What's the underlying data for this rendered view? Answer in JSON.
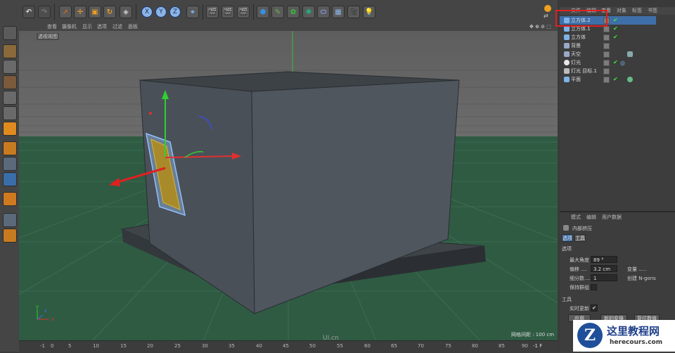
{
  "toolbar": {
    "axes": [
      "X",
      "Y",
      "Z"
    ]
  },
  "viewport": {
    "menu": [
      "查看",
      "摄像机",
      "显示",
      "选项",
      "过滤",
      "面板"
    ],
    "view_label": "透视视图",
    "grid_spacing": "网格间距 : 100 cm",
    "corner_icons": "✥ ⊕ ⊘ ⬚",
    "timeline": {
      "ticks": [
        "-1",
        "0",
        "5",
        "10",
        "15",
        "20",
        "25",
        "30",
        "35",
        "40",
        "45",
        "50",
        "55",
        "60",
        "65",
        "70",
        "75",
        "80",
        "85",
        "90"
      ],
      "frame": "-1 F"
    },
    "watermark": "UI.cn",
    "axis_gizmo": [
      "y",
      "z",
      "x"
    ]
  },
  "object_manager": {
    "menu": [
      "文件",
      "编辑",
      "查看",
      "对象",
      "标签",
      "书签"
    ],
    "objects": [
      {
        "name": "立方体.2",
        "selected": true,
        "color": "#7fb3e8"
      },
      {
        "name": "立方体.1",
        "selected": false,
        "color": "#7fb3e8"
      },
      {
        "name": "立方体",
        "selected": false,
        "color": "#7fb3e8"
      },
      {
        "name": "背景",
        "selected": false,
        "color": "#9aa9c8"
      },
      {
        "name": "天空",
        "selected": false,
        "color": "#9aa9c8"
      },
      {
        "name": "灯光",
        "selected": false,
        "color": "#e8e8e8"
      },
      {
        "name": "灯光 目标.1",
        "selected": false,
        "color": "#bbbbbb"
      },
      {
        "name": "平面",
        "selected": false,
        "color": "#7fb3e8"
      }
    ]
  },
  "attributes": {
    "menu": [
      "模式",
      "编辑",
      "用户数据"
    ],
    "tool_name": "内部挤压",
    "tabs": [
      "选项",
      "工具"
    ],
    "section_options": "选项",
    "max_angle_label": "最大角度",
    "max_angle_value": "89 °",
    "offset_label": "偏移 ....",
    "offset_value": "3.2 cm",
    "var_label": "变量 .....",
    "subdiv_label": "细分数....",
    "subdiv_value": "1",
    "create_ngon_label": "创建 N-gons",
    "keep_groups_label": "保持群组",
    "section_tool": "工具",
    "realtime_label": "实时更新",
    "apply_btn": "应用",
    "new_transform_btn": "新的变换",
    "reset_btn": "复位数值"
  },
  "footer_logo": {
    "title": "这里教程网",
    "url": "herecours.com"
  },
  "colors": {
    "highlight_box": "#e02020",
    "selected_row": "#3f6fa8",
    "ground": "#2f5b43",
    "cube": "#4a5058"
  }
}
